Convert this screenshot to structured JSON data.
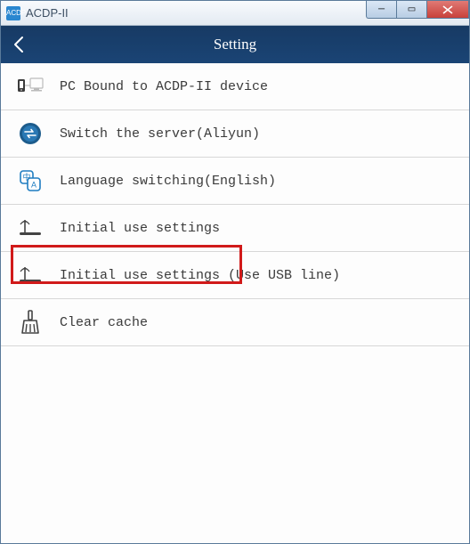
{
  "window": {
    "title": "ACDP-II",
    "icon_text": "ACDP"
  },
  "header": {
    "title": "Setting"
  },
  "menu": {
    "items": [
      {
        "label": "PC Bound to ACDP-II device",
        "icon": "pc-bound"
      },
      {
        "label": "Switch the server(Aliyun)",
        "icon": "server-switch"
      },
      {
        "label": "Language switching(English)",
        "icon": "language"
      },
      {
        "label": "Initial use settings",
        "icon": "wifi-antenna"
      },
      {
        "label": "Initial use settings (Use USB line)",
        "icon": "wifi-antenna"
      },
      {
        "label": "Clear cache",
        "icon": "broom"
      }
    ]
  },
  "highlighted_index": 3
}
